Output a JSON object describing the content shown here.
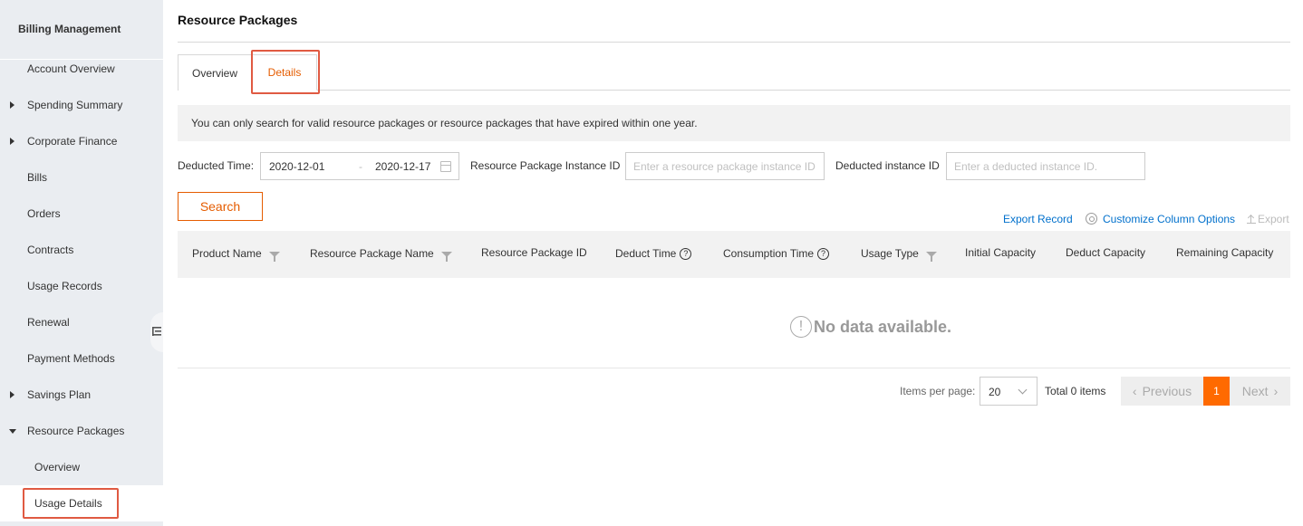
{
  "sidebar": {
    "title": "Billing Management",
    "items": [
      {
        "label": "Account Overview"
      },
      {
        "label": "Spending Summary"
      },
      {
        "label": "Corporate Finance"
      },
      {
        "label": "Bills"
      },
      {
        "label": "Orders"
      },
      {
        "label": "Contracts"
      },
      {
        "label": "Usage Records"
      },
      {
        "label": "Renewal"
      },
      {
        "label": "Payment Methods"
      },
      {
        "label": "Savings Plan"
      },
      {
        "label": "Resource Packages"
      }
    ],
    "sub_items": [
      {
        "label": "Overview"
      },
      {
        "label": "Usage Details"
      }
    ]
  },
  "main": {
    "title": "Resource Packages",
    "tabs": [
      {
        "label": "Overview"
      },
      {
        "label": "Details"
      }
    ],
    "notice": "You can only search for valid resource packages or resource packages that have expired within one year.",
    "filters": {
      "deducted_time_label": "Deducted Time:",
      "date_start": "2020-12-01",
      "date_separator": "-",
      "date_end": "2020-12-17",
      "instance_id_label": "Resource Package Instance ID",
      "instance_id_placeholder": "Enter a resource package instance ID",
      "deducted_instance_label": "Deducted instance ID",
      "deducted_instance_placeholder": "Enter a deducted instance ID."
    },
    "search_button": "Search",
    "toolbar": {
      "export_record": "Export Record",
      "customize_columns": "Customize Column Options",
      "export": "Export"
    },
    "columns": [
      "Product Name",
      "Resource Package Name",
      "Resource Package ID",
      "Deduct Time",
      "Consumption Time",
      "Usage Type",
      "Initial Capacity",
      "Deduct Capacity",
      "Remaining Capacity"
    ],
    "empty_text": "No data available.",
    "pagination": {
      "items_per_page_label": "Items per page:",
      "page_size": "20",
      "total": "Total 0 items",
      "previous": "Previous",
      "current_page": "1",
      "next": "Next"
    }
  },
  "colors": {
    "accent": "#ff6a00",
    "highlight": "#e05a42",
    "link": "#0070cc",
    "sidebar_bg": "#eaedf1"
  }
}
